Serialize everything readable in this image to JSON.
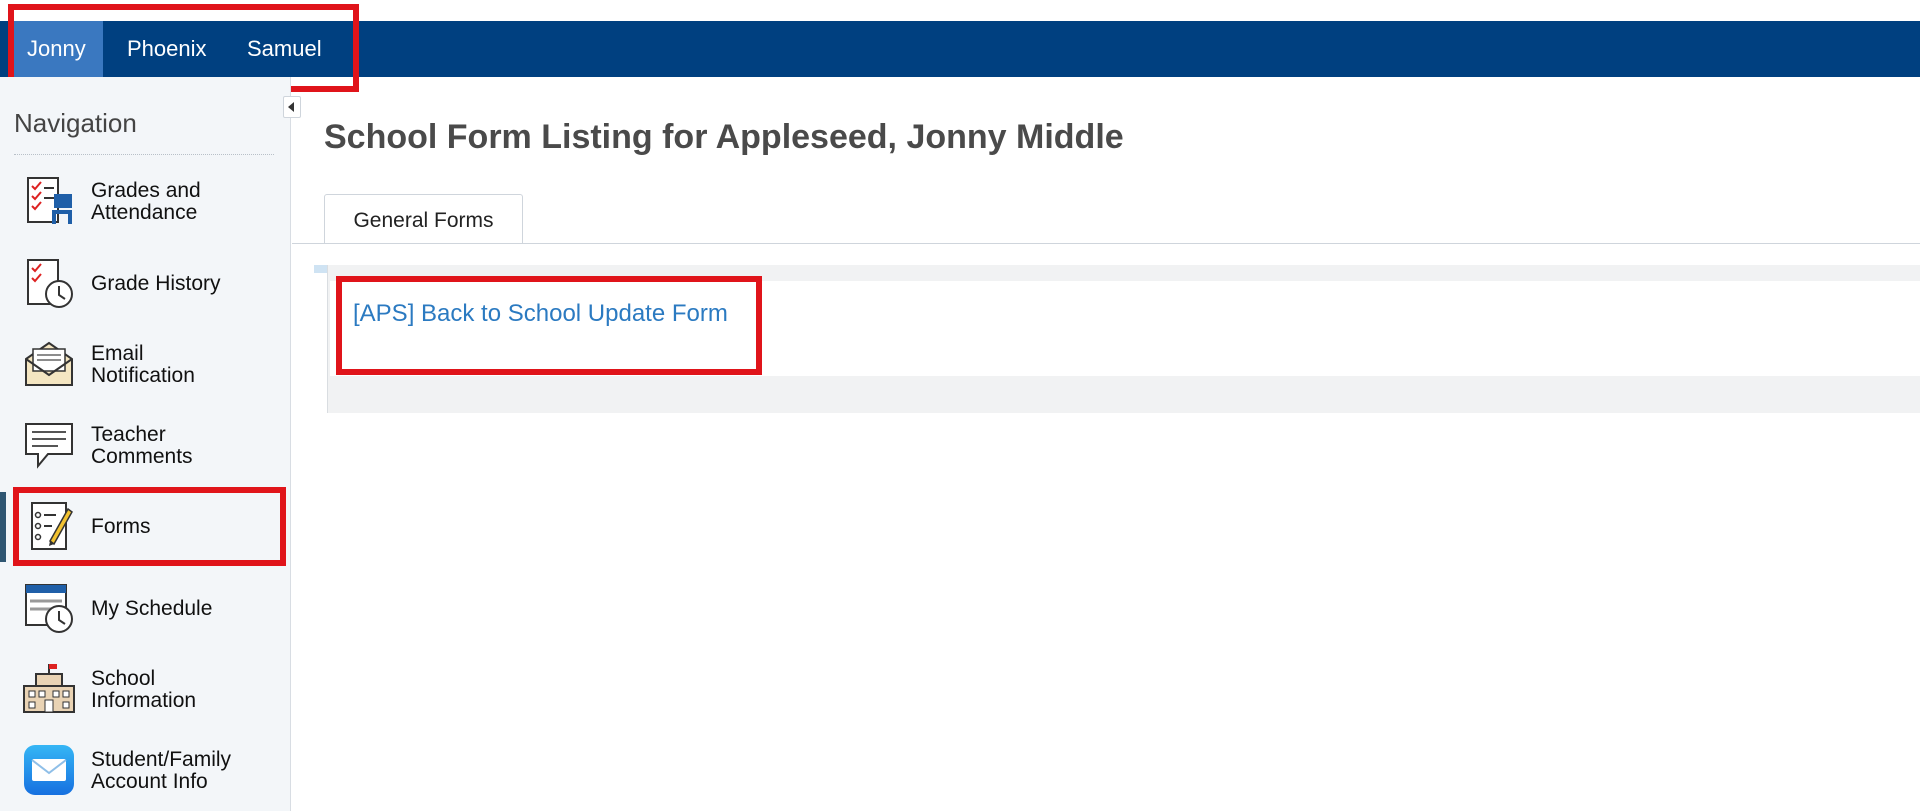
{
  "students": [
    {
      "name": "Jonny",
      "active": true
    },
    {
      "name": "Phoenix",
      "active": false
    },
    {
      "name": "Samuel",
      "active": false
    }
  ],
  "nav": {
    "heading": "Navigation",
    "items": [
      {
        "label": "Grades and Attendance",
        "icon": "grades-attendance-icon"
      },
      {
        "label": "Grade History",
        "icon": "grade-history-icon"
      },
      {
        "label": "Email Notification",
        "icon": "email-notification-icon"
      },
      {
        "label": "Teacher Comments",
        "icon": "teacher-comments-icon"
      },
      {
        "label": "Forms",
        "icon": "forms-icon",
        "active": true
      },
      {
        "label": "My Schedule",
        "icon": "my-schedule-icon"
      },
      {
        "label": "School Information",
        "icon": "school-information-icon"
      },
      {
        "label": "Student/Family Account Info",
        "icon": "account-info-icon"
      }
    ]
  },
  "main": {
    "title": "School Form Listing for Appleseed, Jonny Middle",
    "tabs": [
      {
        "label": "General Forms",
        "active": true
      }
    ],
    "forms": [
      {
        "label": "[APS] Back to School Update Form"
      }
    ]
  },
  "colors": {
    "topbar": "#004080",
    "active_tab": "#3a78c0",
    "link": "#2b7ac1",
    "highlight": "#e0141a"
  }
}
